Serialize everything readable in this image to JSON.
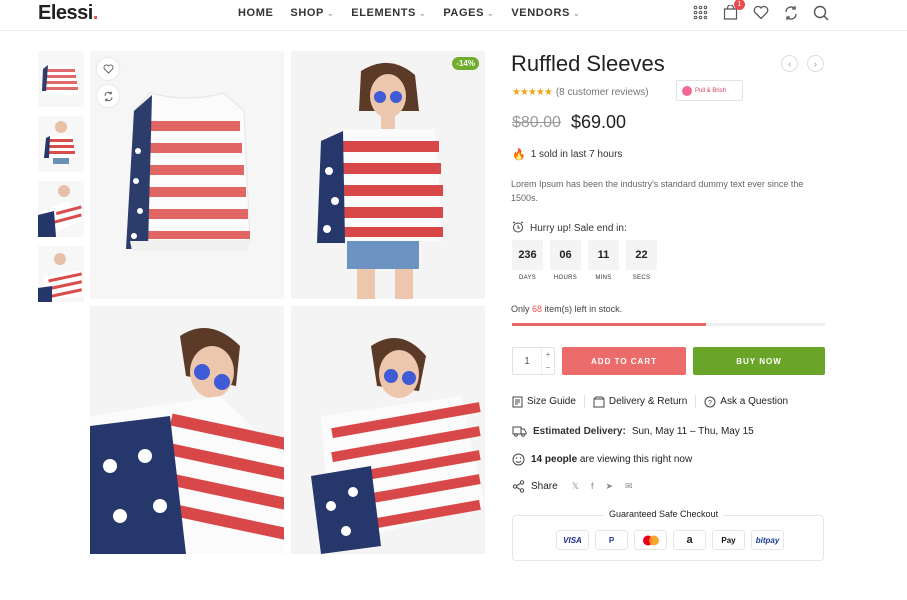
{
  "brand": {
    "name": "Elessi",
    "dot": "."
  },
  "nav": [
    {
      "label": "HOME"
    },
    {
      "label": "SHOP"
    },
    {
      "label": "ELEMENTS"
    },
    {
      "label": "PAGES"
    },
    {
      "label": "VENDORS"
    }
  ],
  "header_icons": {
    "cart_count": "1"
  },
  "gallery": {
    "discount_badge": "-14%"
  },
  "product": {
    "title": "Ruffled Sleeves",
    "rating": 4.5,
    "reviews": "(8 customer reviews)",
    "brand_badge": "Pull & Brish",
    "old_price": "$80.00",
    "new_price": "$69.00",
    "sold_text": "1 sold in last 7 hours",
    "description": "Lorem Ipsum has been the industry's standard dummy text ever since the 1500s."
  },
  "countdown": {
    "heading": "Hurry up! Sale end in:",
    "days": "236",
    "days_label": "DAYS",
    "hours": "06",
    "hours_label": "HOURS",
    "mins": "11",
    "mins_label": "MINS",
    "secs": "22",
    "secs_label": "SECS"
  },
  "stock": {
    "prefix": "Only",
    "count": "68",
    "suffix": "item(s) left in stock.",
    "progress": 0.62
  },
  "purchase": {
    "quantity": "1",
    "add_to_cart": "ADD TO CART",
    "buy_now": "BUY NOW"
  },
  "links": {
    "size_guide": "Size Guide",
    "delivery": "Delivery & Return",
    "ask": "Ask a Question"
  },
  "delivery": {
    "label": "Estimated Delivery:",
    "dates": "Sun, May 11 – Thu, May 15"
  },
  "viewers": {
    "count": "14 people",
    "suffix": "are viewing this right now"
  },
  "share": {
    "label": "Share"
  },
  "checkout": {
    "title": "Guaranteed Safe Checkout",
    "methods": [
      "VISA",
      "P",
      "",
      "a",
      "Pay",
      "bitpay"
    ]
  },
  "colors": {
    "accent": "#ec6b6b",
    "buy": "#6aa529",
    "star": "#f2a51a"
  }
}
